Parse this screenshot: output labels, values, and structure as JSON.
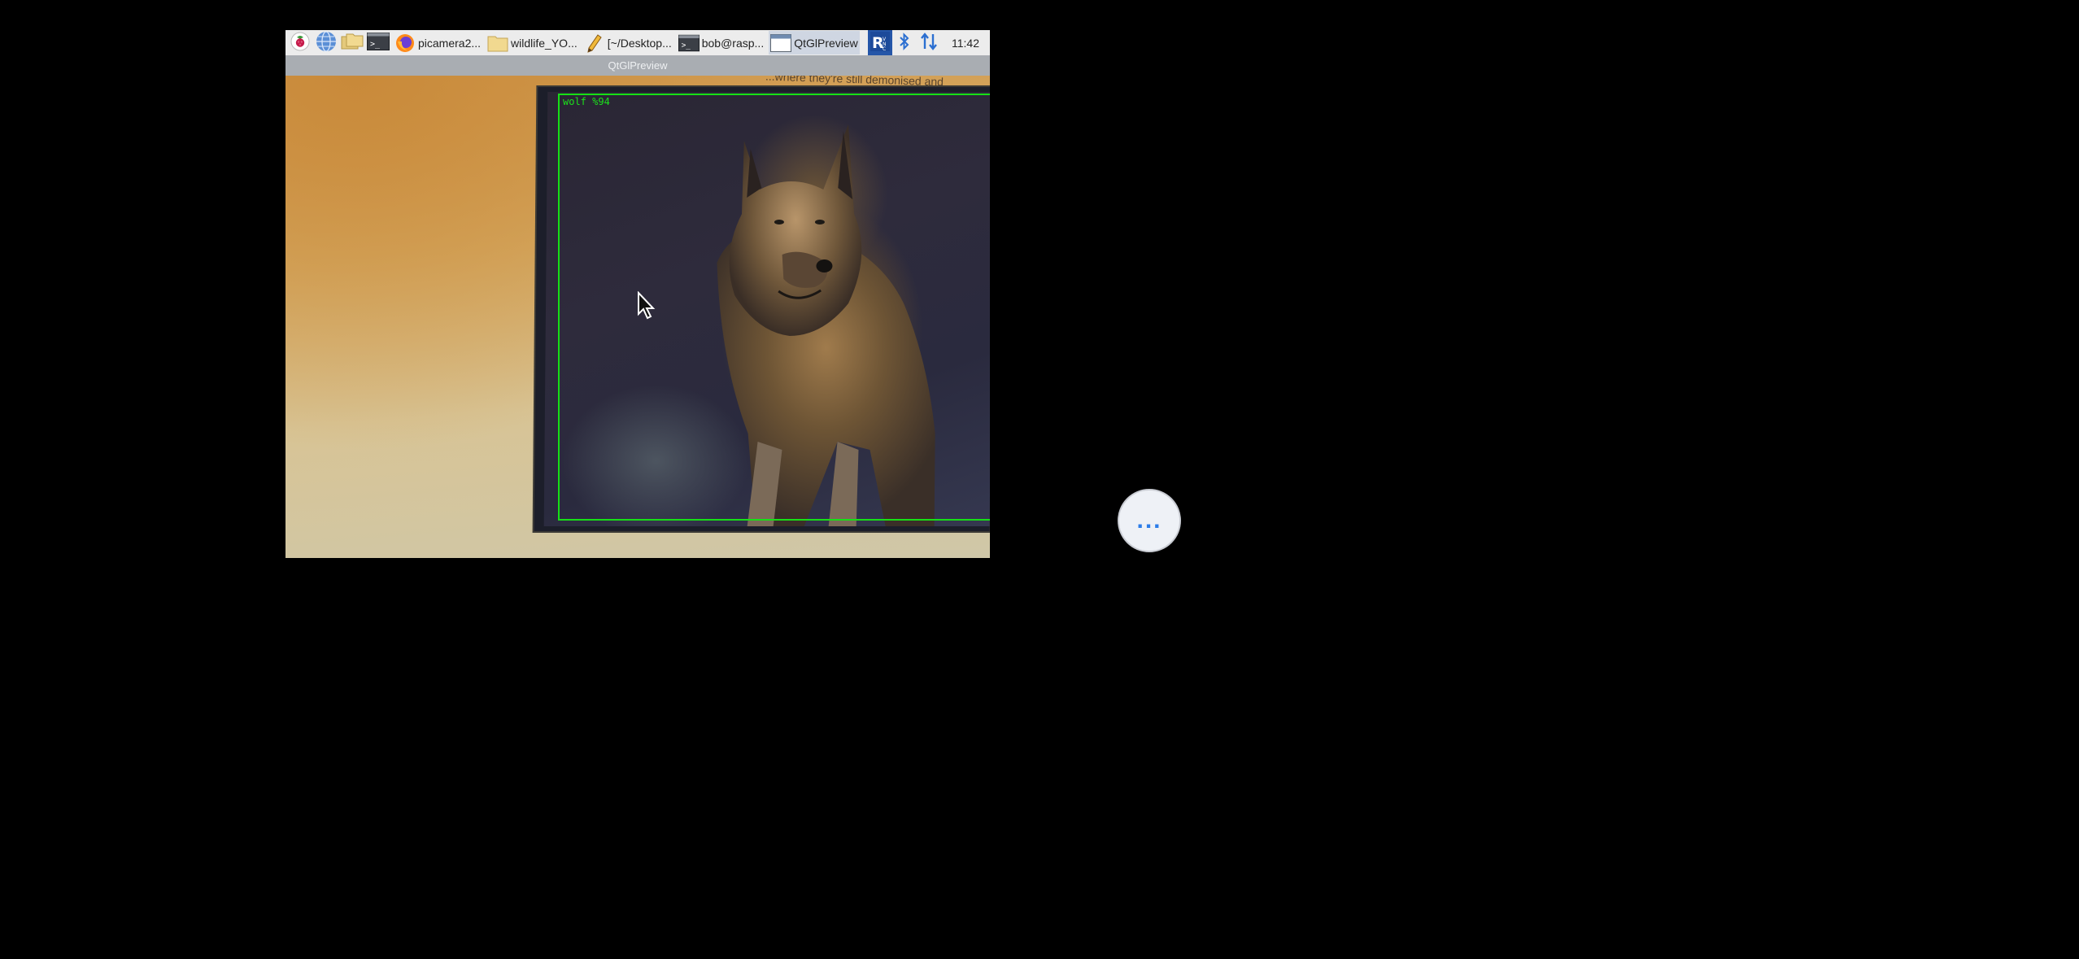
{
  "taskbar": {
    "launchers": [
      {
        "name": "raspberry-menu",
        "icon": "raspberry-icon"
      },
      {
        "name": "web-browser",
        "icon": "globe-icon"
      },
      {
        "name": "file-manager",
        "icon": "folders-icon"
      },
      {
        "name": "terminal",
        "icon": "terminal-icon"
      }
    ],
    "tasks": [
      {
        "label": "picamera2...",
        "icon": "firefox-icon"
      },
      {
        "label": "wildlife_YO...",
        "icon": "folder-icon"
      },
      {
        "label": "[~/Desktop...",
        "icon": "text-editor-icon"
      },
      {
        "label": "bob@rasp...",
        "icon": "terminal-icon"
      },
      {
        "label": "QtGlPreview",
        "icon": "window-icon"
      }
    ],
    "tray": [
      "vnc-icon",
      "bluetooth-icon",
      "network-icon"
    ],
    "clock": "11:42"
  },
  "window": {
    "title": "QtGlPreview"
  },
  "preview": {
    "headline_fragment": "...where they're still demonised and",
    "detection": {
      "label": "wolf %94",
      "box_color": "#16e016"
    }
  },
  "overlay": {
    "more_label": "..."
  },
  "colors": {
    "taskbar_bg": "#ececec",
    "titlebar_bg": "#a9adb2",
    "active_task_bg": "#cfd6e2",
    "accent_blue": "#2b7de9"
  }
}
